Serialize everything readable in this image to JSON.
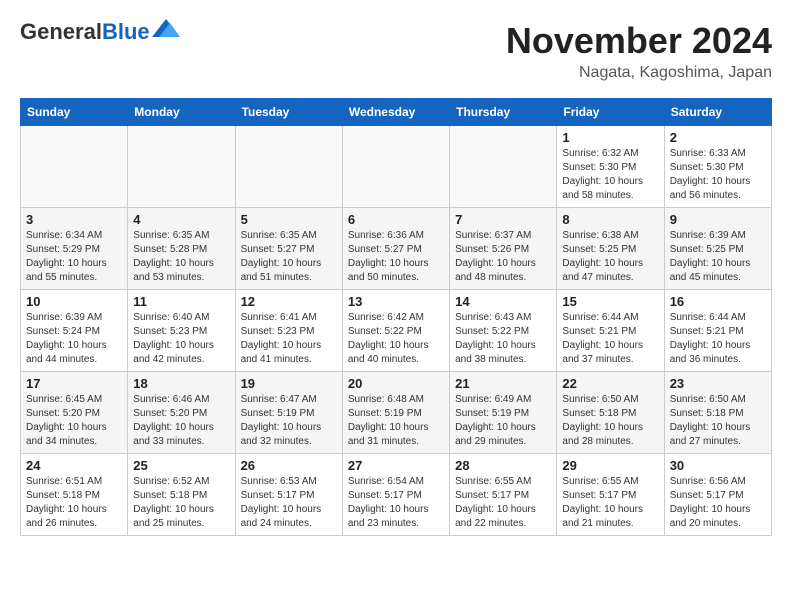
{
  "logo": {
    "line1": "General",
    "line2": "Blue"
  },
  "header": {
    "month": "November 2024",
    "location": "Nagata, Kagoshima, Japan"
  },
  "weekdays": [
    "Sunday",
    "Monday",
    "Tuesday",
    "Wednesday",
    "Thursday",
    "Friday",
    "Saturday"
  ],
  "weeks": [
    [
      {
        "day": "",
        "info": ""
      },
      {
        "day": "",
        "info": ""
      },
      {
        "day": "",
        "info": ""
      },
      {
        "day": "",
        "info": ""
      },
      {
        "day": "",
        "info": ""
      },
      {
        "day": "1",
        "info": "Sunrise: 6:32 AM\nSunset: 5:30 PM\nDaylight: 10 hours\nand 58 minutes."
      },
      {
        "day": "2",
        "info": "Sunrise: 6:33 AM\nSunset: 5:30 PM\nDaylight: 10 hours\nand 56 minutes."
      }
    ],
    [
      {
        "day": "3",
        "info": "Sunrise: 6:34 AM\nSunset: 5:29 PM\nDaylight: 10 hours\nand 55 minutes."
      },
      {
        "day": "4",
        "info": "Sunrise: 6:35 AM\nSunset: 5:28 PM\nDaylight: 10 hours\nand 53 minutes."
      },
      {
        "day": "5",
        "info": "Sunrise: 6:35 AM\nSunset: 5:27 PM\nDaylight: 10 hours\nand 51 minutes."
      },
      {
        "day": "6",
        "info": "Sunrise: 6:36 AM\nSunset: 5:27 PM\nDaylight: 10 hours\nand 50 minutes."
      },
      {
        "day": "7",
        "info": "Sunrise: 6:37 AM\nSunset: 5:26 PM\nDaylight: 10 hours\nand 48 minutes."
      },
      {
        "day": "8",
        "info": "Sunrise: 6:38 AM\nSunset: 5:25 PM\nDaylight: 10 hours\nand 47 minutes."
      },
      {
        "day": "9",
        "info": "Sunrise: 6:39 AM\nSunset: 5:25 PM\nDaylight: 10 hours\nand 45 minutes."
      }
    ],
    [
      {
        "day": "10",
        "info": "Sunrise: 6:39 AM\nSunset: 5:24 PM\nDaylight: 10 hours\nand 44 minutes."
      },
      {
        "day": "11",
        "info": "Sunrise: 6:40 AM\nSunset: 5:23 PM\nDaylight: 10 hours\nand 42 minutes."
      },
      {
        "day": "12",
        "info": "Sunrise: 6:41 AM\nSunset: 5:23 PM\nDaylight: 10 hours\nand 41 minutes."
      },
      {
        "day": "13",
        "info": "Sunrise: 6:42 AM\nSunset: 5:22 PM\nDaylight: 10 hours\nand 40 minutes."
      },
      {
        "day": "14",
        "info": "Sunrise: 6:43 AM\nSunset: 5:22 PM\nDaylight: 10 hours\nand 38 minutes."
      },
      {
        "day": "15",
        "info": "Sunrise: 6:44 AM\nSunset: 5:21 PM\nDaylight: 10 hours\nand 37 minutes."
      },
      {
        "day": "16",
        "info": "Sunrise: 6:44 AM\nSunset: 5:21 PM\nDaylight: 10 hours\nand 36 minutes."
      }
    ],
    [
      {
        "day": "17",
        "info": "Sunrise: 6:45 AM\nSunset: 5:20 PM\nDaylight: 10 hours\nand 34 minutes."
      },
      {
        "day": "18",
        "info": "Sunrise: 6:46 AM\nSunset: 5:20 PM\nDaylight: 10 hours\nand 33 minutes."
      },
      {
        "day": "19",
        "info": "Sunrise: 6:47 AM\nSunset: 5:19 PM\nDaylight: 10 hours\nand 32 minutes."
      },
      {
        "day": "20",
        "info": "Sunrise: 6:48 AM\nSunset: 5:19 PM\nDaylight: 10 hours\nand 31 minutes."
      },
      {
        "day": "21",
        "info": "Sunrise: 6:49 AM\nSunset: 5:19 PM\nDaylight: 10 hours\nand 29 minutes."
      },
      {
        "day": "22",
        "info": "Sunrise: 6:50 AM\nSunset: 5:18 PM\nDaylight: 10 hours\nand 28 minutes."
      },
      {
        "day": "23",
        "info": "Sunrise: 6:50 AM\nSunset: 5:18 PM\nDaylight: 10 hours\nand 27 minutes."
      }
    ],
    [
      {
        "day": "24",
        "info": "Sunrise: 6:51 AM\nSunset: 5:18 PM\nDaylight: 10 hours\nand 26 minutes."
      },
      {
        "day": "25",
        "info": "Sunrise: 6:52 AM\nSunset: 5:18 PM\nDaylight: 10 hours\nand 25 minutes."
      },
      {
        "day": "26",
        "info": "Sunrise: 6:53 AM\nSunset: 5:17 PM\nDaylight: 10 hours\nand 24 minutes."
      },
      {
        "day": "27",
        "info": "Sunrise: 6:54 AM\nSunset: 5:17 PM\nDaylight: 10 hours\nand 23 minutes."
      },
      {
        "day": "28",
        "info": "Sunrise: 6:55 AM\nSunset: 5:17 PM\nDaylight: 10 hours\nand 22 minutes."
      },
      {
        "day": "29",
        "info": "Sunrise: 6:55 AM\nSunset: 5:17 PM\nDaylight: 10 hours\nand 21 minutes."
      },
      {
        "day": "30",
        "info": "Sunrise: 6:56 AM\nSunset: 5:17 PM\nDaylight: 10 hours\nand 20 minutes."
      }
    ]
  ]
}
